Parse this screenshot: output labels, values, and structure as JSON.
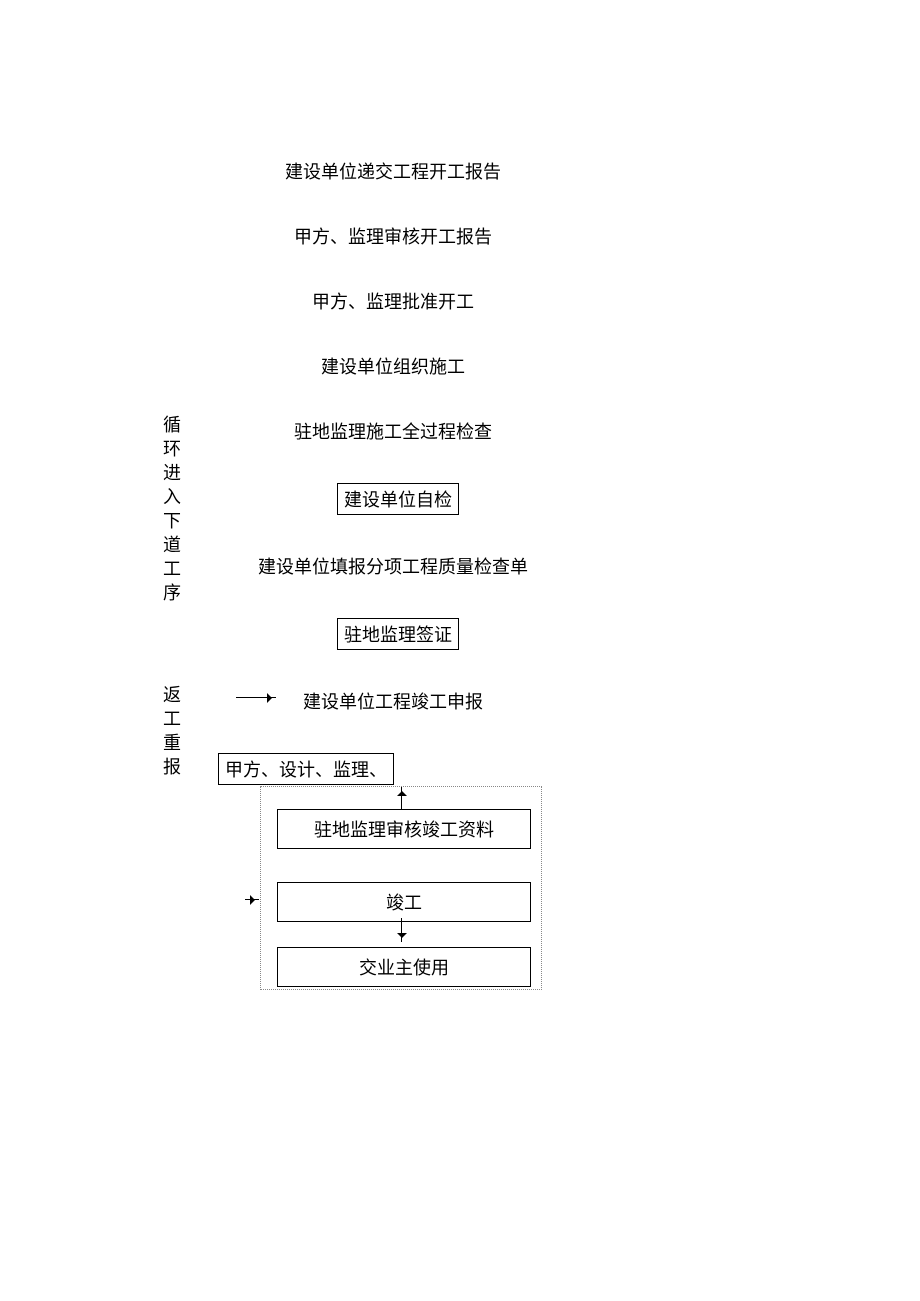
{
  "steps": {
    "s1": "建设单位递交工程开工报告",
    "s2": "甲方、监理审核开工报告",
    "s3": "甲方、监理批准开工",
    "s4": "建设单位组织施工",
    "s5": "驻地监理施工全过程检查",
    "s6": "建设单位自检",
    "s7": "建设单位填报分项工程质量检查单",
    "s8": "驻地监理签证",
    "s9": "建设单位工程竣工申报",
    "s10": "甲方、设计、监理、",
    "s11": "驻地监理审核竣工资料",
    "s12": "竣工",
    "s13": "交业主使用"
  },
  "side": {
    "loop": "循环进入下道工序",
    "rework": "返工重报"
  }
}
